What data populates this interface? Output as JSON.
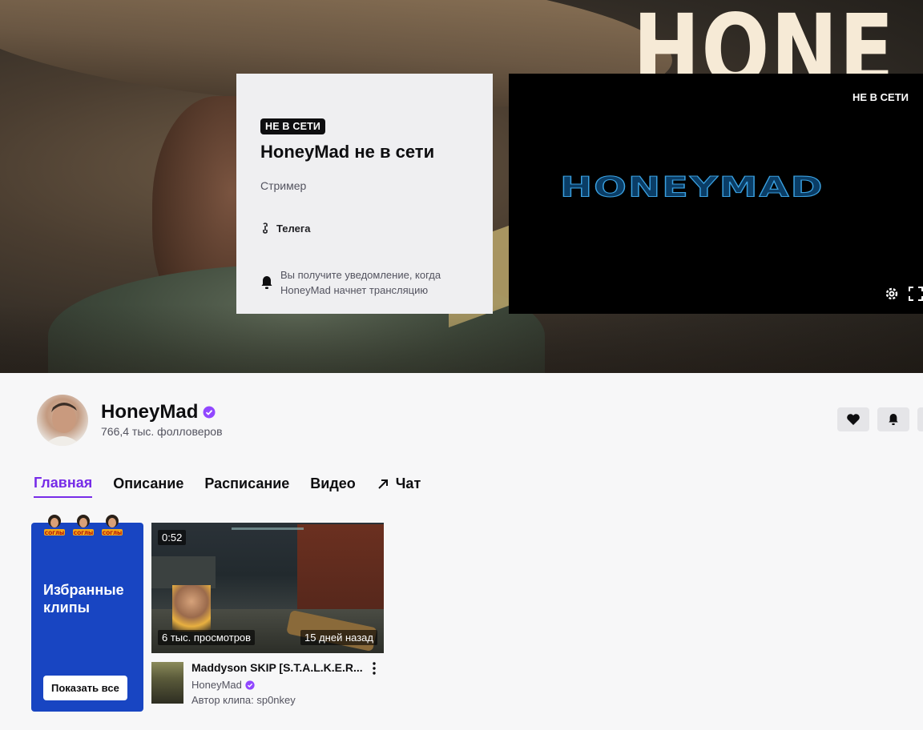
{
  "banner": {
    "background_text": "HONE"
  },
  "offline_card": {
    "badge": "НЕ В СЕТИ",
    "title": "HoneyMad не в сети",
    "role": "Стример",
    "link_label": "Телега",
    "notify_text": "Вы получите уведомление, когда HoneyMad начнет трансляцию"
  },
  "player": {
    "status": "НЕ В СЕТИ",
    "logo_text": "HONEYMAD"
  },
  "channel": {
    "name": "HoneyMad",
    "followers": "766,4 тыс. фолловеров",
    "verified_color": "#9147ff"
  },
  "tabs": [
    {
      "label": "Главная",
      "active": true
    },
    {
      "label": "Описание"
    },
    {
      "label": "Расписание"
    },
    {
      "label": "Видео"
    },
    {
      "label": "Чат"
    }
  ],
  "featured": {
    "title": "Избранные клипы",
    "button": "Показать все",
    "coin_label": "СОГЛЫ"
  },
  "clip": {
    "duration": "0:52",
    "views": "6 тыс. просмотров",
    "ago": "15 дней назад",
    "title": "Maddyson SKIP [S.T.A.L.K.E.R...",
    "channel": "HoneyMad",
    "author": "Автор клипа: sp0nkey"
  },
  "colors": {
    "accent": "#772ce8",
    "featured_bg": "#1845c2"
  }
}
